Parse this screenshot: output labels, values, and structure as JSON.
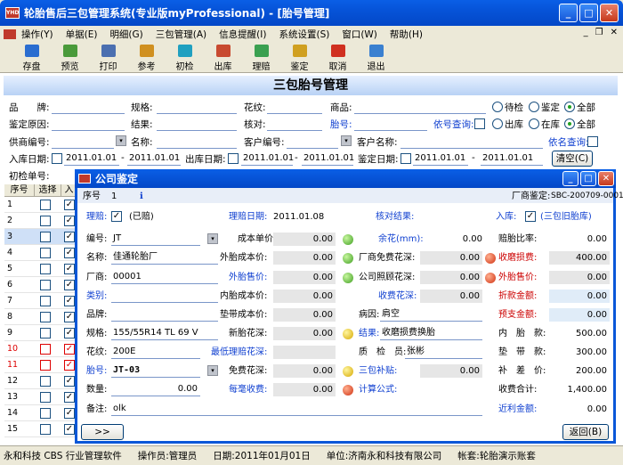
{
  "app": {
    "title": "轮胎售后三包管理系统(专业版myProfessional) - [胎号管理]"
  },
  "menu": [
    "操作(Y)",
    "单据(E)",
    "明细(G)",
    "三包管理(A)",
    "信息提醒(I)",
    "系统设置(S)",
    "窗口(W)",
    "帮助(H)"
  ],
  "toolbar": [
    {
      "label": "存盘",
      "color": "#2a6dd0"
    },
    {
      "label": "预览",
      "color": "#4a9a3a"
    },
    {
      "label": "打印",
      "color": "#4b6fb0"
    },
    {
      "label": "参考",
      "color": "#d09020"
    },
    {
      "label": "初检",
      "color": "#20a0c0"
    },
    {
      "label": "出库",
      "color": "#c84a30"
    },
    {
      "label": "理赔",
      "color": "#3aa050"
    },
    {
      "label": "鉴定",
      "color": "#d0a020"
    },
    {
      "label": "取消",
      "color": "#d03020"
    },
    {
      "label": "退出",
      "color": "#3a80d0"
    }
  ],
  "filter": {
    "banner": "三包胎号管理",
    "brand": "品　　牌:",
    "spec": "规格:",
    "pattern": "花纹:",
    "product": "商品:",
    "reason": "鉴定原因:",
    "result": "结果:",
    "verify": "核对:",
    "tire_no": "胎号:",
    "tire_query": "依号查询:",
    "supplier_no": "供商编号:",
    "name": "名称:",
    "customer_no": "客户编号:",
    "customer_name": "客户名称:",
    "name_query": "依名查询:",
    "in_date": "入库日期:",
    "out_date": "出库日期:",
    "appraise_date": "鉴定日期:",
    "date_from": "2011.01.01",
    "date_to": "2011.01.01",
    "dash": "-",
    "first_check_no": "初检单号:",
    "clear": "清空(C)",
    "r1": [
      "待检",
      "鉴定",
      "全部"
    ],
    "r2": [
      "出库",
      "在库",
      "全部"
    ]
  },
  "grid": {
    "headers": [
      "序号",
      "选择",
      "入库"
    ],
    "rows": [
      "1",
      "2",
      "3",
      "4",
      "5",
      "6",
      "7",
      "8",
      "9",
      "10",
      "11",
      "12",
      "13",
      "14",
      "15"
    ]
  },
  "dialog": {
    "title": "公司鉴定",
    "seq_label": "序号",
    "seq": "1",
    "maker_label": "厂商鉴定:",
    "maker": "SBC-200709-0001",
    "claim": "理赔:",
    "claimed": "(已赔)",
    "claim_date_label": "理赔日期:",
    "claim_date": "2011.01.08",
    "verify_result": "核对结果:",
    "in_stock": "入库:",
    "in_stock_val": "(三包旧胎库)",
    "code": "编号:",
    "code_val": "JT",
    "cost": "成本单价:",
    "cost_val": "0.00",
    "remain": "余花(mm):",
    "remain_val": "0.00",
    "ratio": "赔胎比率:",
    "ratio_val": "0.00",
    "name": "名称:",
    "name_val": "佳通轮胎厂",
    "out_cost": "外胎成本价:",
    "out_cost_val": "0.00",
    "free_tread": "厂商免费花深:",
    "free_tread_val": "0.00",
    "wear_loss": "收磨损费:",
    "wear_loss_val": "400.00",
    "vendor": "厂商:",
    "vendor_val": "00001",
    "company_tread": "公司照顾花深:",
    "company_tread_val": "0.00",
    "out_price": "外胎售价:",
    "out_price_val": "0.00",
    "category": "类别:",
    "in_cost": "内胎成本价:",
    "in_cost_val": "0.00",
    "charge_tread": "收费花深:",
    "charge_tread_val": "0.00",
    "discount": "折款金额:",
    "discount_val": "0.00",
    "brand": "品牌:",
    "pad_cost": "垫带成本价:",
    "pad_cost_val": "0.00",
    "cause": "病因:",
    "cause_val": "肩空",
    "prepay": "预支金额:",
    "prepay_val": "0.00",
    "spec": "规格:",
    "spec_val": "155/55R14 TL 69 V",
    "new_price": "新胎花深:",
    "new_price_val": "0.00",
    "conclusion": "结果:",
    "conclusion_val": "收磨损费换胎",
    "in_tire": "内　胎　款:",
    "in_tire_val": "500.00",
    "pattern": "花纹:",
    "pattern_val": "200E",
    "min_tread": "最低理赔花深:",
    "inspector": "质　检　员:",
    "inspector_val": "张彬",
    "pad": "垫　带　款:",
    "pad_val": "300.00",
    "tire_no": "胎号:",
    "tire_no_val": "JT-03",
    "free_tread2": "免费花深:",
    "free_tread2_val": "0.00",
    "subsidy": "三包补贴:",
    "subsidy_val": "0.00",
    "supp": "补　差　价:",
    "supp_val": "200.00",
    "qty": "数量:",
    "qty_val": "0.00",
    "hao_fee": "每毫收费:",
    "hao_fee_val": "0.00",
    "formula": "计算公式:",
    "total": "收费合计:",
    "total_val": "1,400.00",
    "note": "备注:",
    "note_val": "olk",
    "recent": "近利金额:",
    "recent_val": "0.00",
    "more": ">>",
    "back": "返回(B)"
  },
  "status": [
    "永和科技 CBS 行业管理软件",
    "操作员:管理员",
    "日期:2011年01月01日",
    "单位:济南永和科技有限公司",
    "帐套:轮胎演示账套"
  ]
}
